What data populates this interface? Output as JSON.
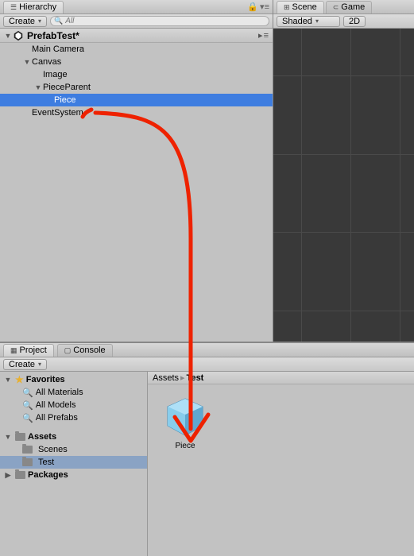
{
  "hierarchy": {
    "tab_label": "Hierarchy",
    "create_label": "Create",
    "search_placeholder": "All",
    "scene_name": "PrefabTest*",
    "items": [
      {
        "label": "Main Camera",
        "indent": 1,
        "fold": ""
      },
      {
        "label": "Canvas",
        "indent": 1,
        "fold": "▼"
      },
      {
        "label": "Image",
        "indent": 2,
        "fold": ""
      },
      {
        "label": "PieceParent",
        "indent": 2,
        "fold": "▼"
      },
      {
        "label": "Piece",
        "indent": 3,
        "fold": "",
        "selected": true,
        "prefab": true
      },
      {
        "label": "EventSystem",
        "indent": 1,
        "fold": ""
      }
    ]
  },
  "scene": {
    "tab_label": "Scene",
    "game_tab_label": "Game",
    "shading_mode": "Shaded",
    "mode_2d": "2D"
  },
  "project": {
    "tab_label": "Project",
    "console_tab_label": "Console",
    "create_label": "Create",
    "favorites_label": "Favorites",
    "fav_items": [
      "All Materials",
      "All Models",
      "All Prefabs"
    ],
    "assets_label": "Assets",
    "asset_folders": [
      "Scenes",
      "Test"
    ],
    "selected_folder": "Test",
    "packages_label": "Packages",
    "breadcrumb": [
      "Assets",
      "Test"
    ],
    "grid_items": [
      {
        "name": "Piece",
        "type": "prefab"
      }
    ]
  }
}
